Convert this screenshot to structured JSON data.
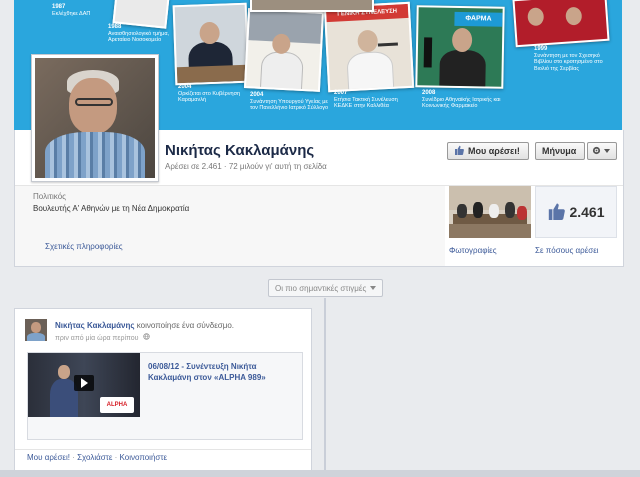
{
  "cover": {
    "captions": [
      {
        "year": "1987",
        "text": "Εκλέχθηκε ΔΑΠ"
      },
      {
        "year": "1988",
        "text": "Αναισθησιολογικό τμήμα, Αρεταίειο Νοσοκομείο"
      },
      {
        "year": "2004",
        "text": "Ορκίζεται στο Κυβέρνηση Καραμανλή"
      },
      {
        "year": "2004",
        "text": "Συνάντηση Υπουργού Υγείας με τον Πανελλήνιο Ιατρικό Σύλλογο"
      },
      {
        "year": "2007",
        "text": "Ετήσια Τακτική Συνέλευση ΚΕΔΚΕ στην Καλλιθέα"
      },
      {
        "year": "2008",
        "text": "Συνέδριο Αθηναϊκής Ιατρικής και Κοινωνικής Φαρμακείο"
      },
      {
        "year": "1999",
        "text": "Συνάντηση με τον Σχεσηκό Βιβλίου στο κροτησμένο στο Βιολιό της Σερβίας"
      }
    ],
    "banner_text_1": "ΓΕΝΙΚΗ ΣΥΝΕΛΕΥΣΗ",
    "banner_text_2": "ΦΑΡΜΑ"
  },
  "profile": {
    "name": "Νικήτας Κακλαμάνης",
    "likes_line": "Αρέσει σε 2.461 · 72 μιλούν γι' αυτή τη σελίδα",
    "like_button": "Μου αρέσει!",
    "message_button": "Μήνυμα",
    "category": "Πολιτικός",
    "description": "Βουλευτής Α' Αθηνών με τη Νέα Δημοκρατία",
    "about_link": "Σχετικές πληροφορίες",
    "photos_label": "Φωτογραφίες",
    "like_count": "2.461",
    "like_count_label": "Σε πόσους αρέσει"
  },
  "timeline": {
    "highlights_button": "Οι πιο σημαντικές στιγμές"
  },
  "post": {
    "author": "Νικήτας Κακλαμάνης",
    "action": "κοινοποίησε ένα σύνδεσμο.",
    "time": "πριν από μία ώρα περίπου",
    "attachment_title": "06/08/12 - Συνέντευξη Νικήτα Κακλαμάνη στον «ALPHA 989»",
    "channel_logo": "ALPHA",
    "actions": [
      "Μου αρέσει!",
      "Σχολιάστε",
      "Κοινοποιήστε"
    ]
  },
  "colors": {
    "cover_blue": "#2aa6dd",
    "link_blue": "#3b5998",
    "name_navy": "#1c2a47"
  },
  "icons": [
    "thumbs-up-icon",
    "gear-icon",
    "chevron-down-icon",
    "globe-icon",
    "play-icon",
    "check-icon"
  ]
}
